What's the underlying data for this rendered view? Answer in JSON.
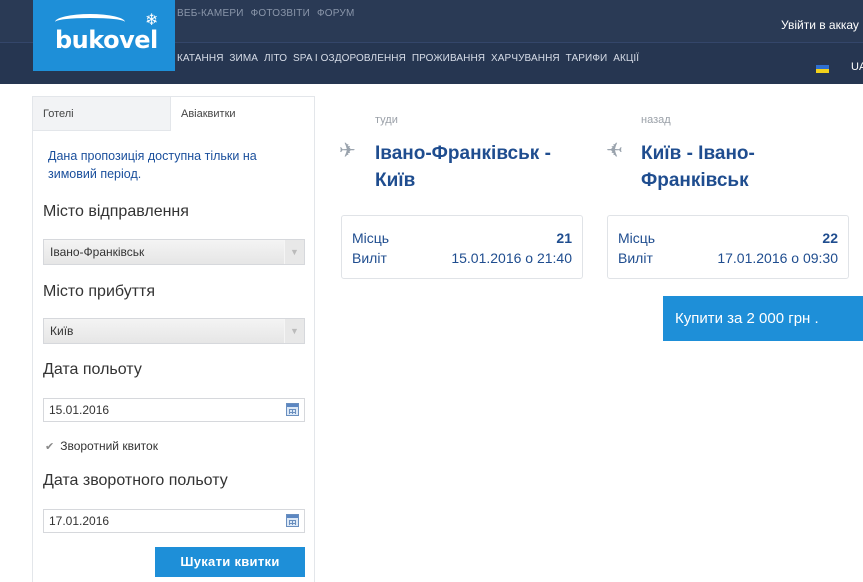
{
  "header": {
    "logo_text": "bukovel",
    "top_links": [
      "ВЕБ-КАМЕРИ",
      "ФОТОЗВІТИ",
      "ФОРУМ"
    ],
    "main_links": [
      "КАТАННЯ",
      "ЗИМА",
      "ЛІТО",
      "SPA І ОЗДОРОВЛЕННЯ",
      "ПРОЖИВАННЯ",
      "ХАРЧУВАННЯ",
      "ТАРИФИ",
      "АКЦІЇ"
    ],
    "login": "Увійти в аккау",
    "lang": "UA",
    "flag_colors": [
      "#2e6fd1",
      "#f2d21b"
    ]
  },
  "sidebar": {
    "tabs": [
      "Готелі",
      "Авіаквитки"
    ],
    "notice": "Дана пропозиція доступна тільки на зимовий період.",
    "departure_label": "Місто відправлення",
    "departure_value": "Івано-Франківськ",
    "arrival_label": "Місто прибуття",
    "arrival_value": "Київ",
    "date_label": "Дата польоту",
    "date_value": "15.01.2016",
    "return_checkbox": "Зворотний квиток",
    "return_date_label": "Дата зворотного польоту",
    "return_date_value": "17.01.2016",
    "search_button": "Шукати квитки"
  },
  "flights": {
    "outbound": {
      "direction": "туди",
      "route": "Івано-Франківськ - Київ",
      "seats_label": "Місць",
      "seats": "21",
      "departure_label": "Виліт",
      "departure": "15.01.2016 о 21:40"
    },
    "return": {
      "direction": "назад",
      "route": "Київ - Івано-Франківськ",
      "seats_label": "Місць",
      "seats": "22",
      "departure_label": "Виліт",
      "departure": "17.01.2016 о 09:30"
    },
    "buy_button": "Купити за 2 000 грн ."
  },
  "colors": {
    "header": "#2a3a55",
    "accent": "#1e8fd8",
    "route_text": "#1f4d8f"
  }
}
